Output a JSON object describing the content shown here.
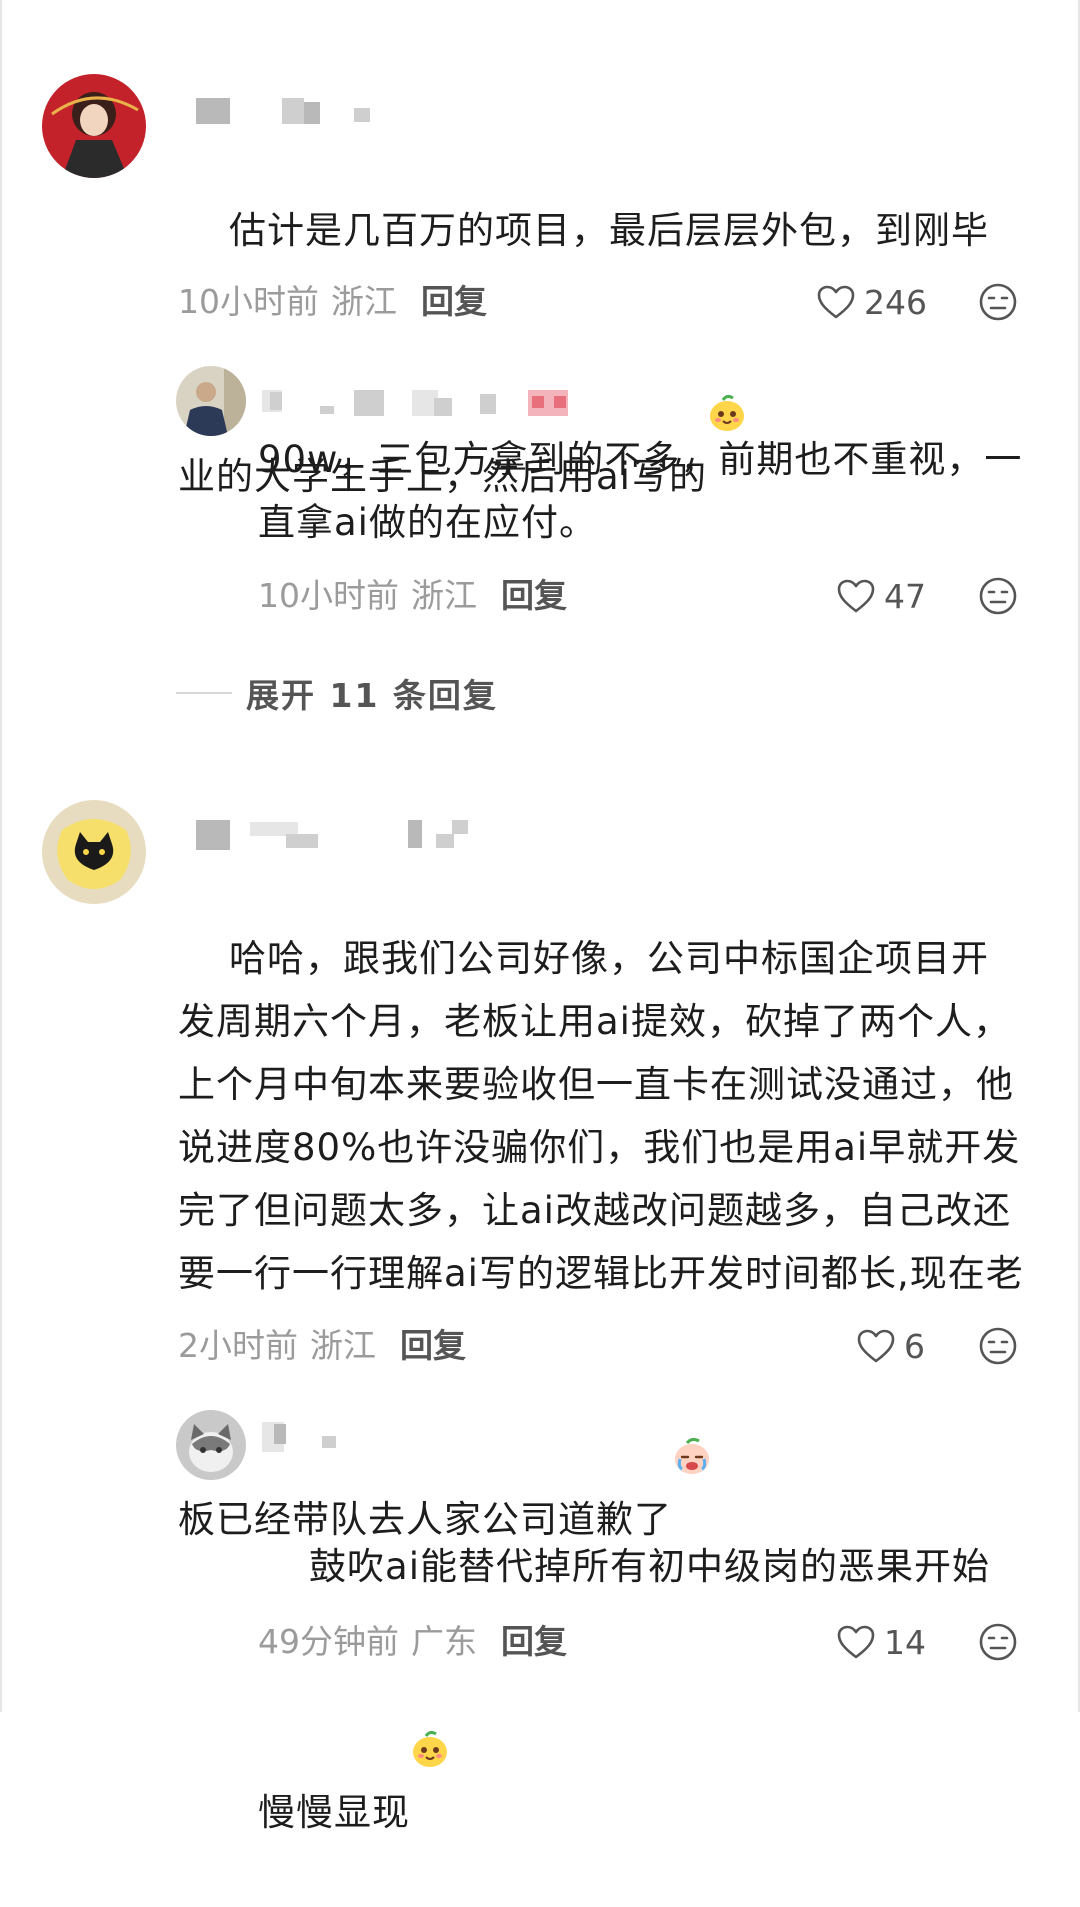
{
  "comments": [
    {
      "text": "估计是几百万的项目，最后层层外包，到刚毕业的大学生手上，然后用ai写的",
      "emoji": "smiling-face-emoji",
      "time": "10小时前",
      "location": "浙江",
      "reply_label": "回复",
      "likes": "246"
    },
    {
      "text": "90w，三包方拿到的不多，前期也不重视，一直拿ai做的在应付。",
      "time": "10小时前",
      "location": "浙江",
      "reply_label": "回复",
      "likes": "47"
    },
    {
      "text": "哈哈，跟我们公司好像，公司中标国企项目开发周期六个月，老板让用ai提效，砍掉了两个人，上个月中旬本来要验收但一直卡在测试没通过，他说进度80%也许没骗你们，我们也是用ai早就开发完了但问题太多，让ai改越改问题越多，自己改还要一行一行理解ai写的逻辑比开发时间都长,现在老板已经带队去人家公司道歉了",
      "emoji": "crying-face-emoji",
      "time": "2小时前",
      "location": "浙江",
      "reply_label": "回复",
      "likes": "6"
    },
    {
      "text": "鼓吹ai能替代掉所有初中级岗的恶果开始慢慢显现",
      "emoji": "smiling-face-emoji",
      "time": "49分钟前",
      "location": "广东",
      "reply_label": "回复",
      "likes": "14"
    }
  ],
  "expand_label": "展开 11 条回复",
  "colors": {
    "text": "#1d1d1d",
    "meta": "#9b9b9b",
    "action": "#555555"
  }
}
